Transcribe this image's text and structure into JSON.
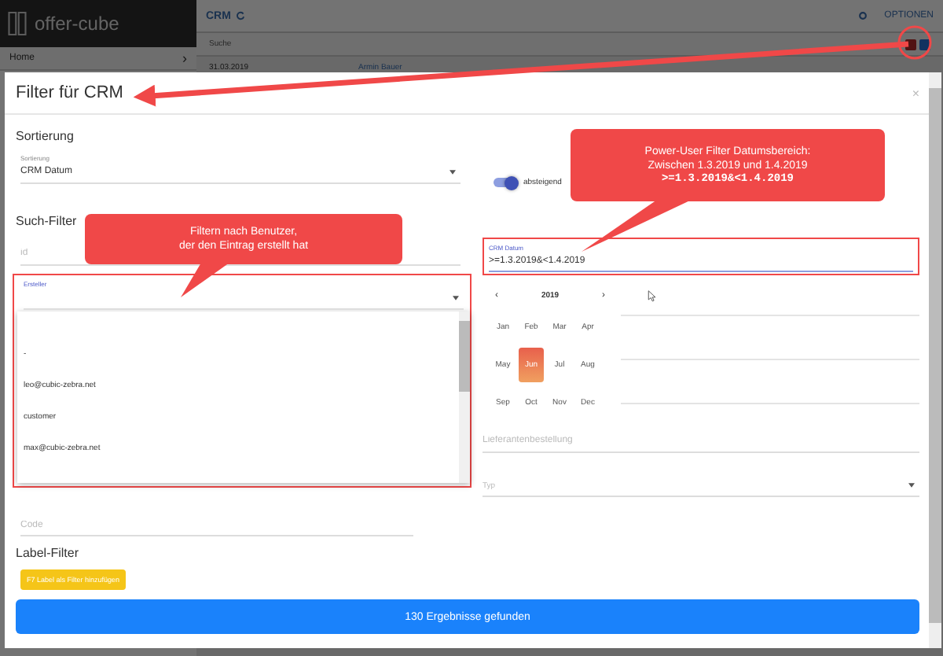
{
  "app": {
    "logo": "offer-cube",
    "sidebar_items": [
      {
        "label": "Home",
        "chevron": "›"
      }
    ],
    "header_title": "CRM",
    "options_label": "OPTIONEN",
    "search_label": "Suche",
    "row": {
      "date": "31.03.2019",
      "user": "Armin Bauer"
    }
  },
  "modal": {
    "title": "Filter für CRM",
    "close": "×",
    "sort": {
      "heading": "Sortierung",
      "field_label": "Sortierung",
      "value": "CRM Datum",
      "toggle_label": "absteigend",
      "toggle_on": true
    },
    "search": {
      "heading": "Such-Filter",
      "id_placeholder": "id",
      "creator_label": "Ersteller",
      "creator_options": [
        "-",
        "leo@cubic-zebra.net",
        "customer",
        "max@cubic-zebra.net"
      ],
      "date_label": "CRM Datum",
      "date_value": ">=1.3.2019&<1.4.2019",
      "picker": {
        "year": "2019",
        "prev": "‹",
        "next": "›",
        "months": [
          {
            "label": "Jan",
            "selected": false
          },
          {
            "label": "Feb",
            "selected": false
          },
          {
            "label": "Mar",
            "selected": false
          },
          {
            "label": "Apr",
            "selected": false
          },
          {
            "label": "May",
            "selected": false
          },
          {
            "label": "Jun",
            "selected": true
          },
          {
            "label": "Jul",
            "selected": false
          },
          {
            "label": "Aug",
            "selected": false
          },
          {
            "label": "Sep",
            "selected": false
          },
          {
            "label": "Oct",
            "selected": false
          },
          {
            "label": "Nov",
            "selected": false
          },
          {
            "label": "Dec",
            "selected": false
          }
        ]
      },
      "supplier_placeholder": "Lieferantenbestellung",
      "type_placeholder": "Typ",
      "code_placeholder": "Code"
    },
    "label_filter": {
      "heading": "Label-Filter",
      "button": "F7 Label als Filter hinzufügen"
    },
    "result_button": "130 Ergebnisse gefunden"
  },
  "annotations": [
    {
      "lines": [
        {
          "kind": "plain",
          "text": "Power-User Filter Datumsbereich:"
        },
        {
          "kind": "plain",
          "text": "Zwischen 1.3.2019 und 1.4.2019"
        },
        {
          "kind": "code",
          "text": ">=1.3.2019&<1.4.2019"
        }
      ]
    },
    {
      "lines": [
        {
          "kind": "plain",
          "text": "Filtern nach Benutzer,"
        },
        {
          "kind": "plain",
          "text": "der den Eintrag erstellt hat"
        }
      ]
    }
  ]
}
